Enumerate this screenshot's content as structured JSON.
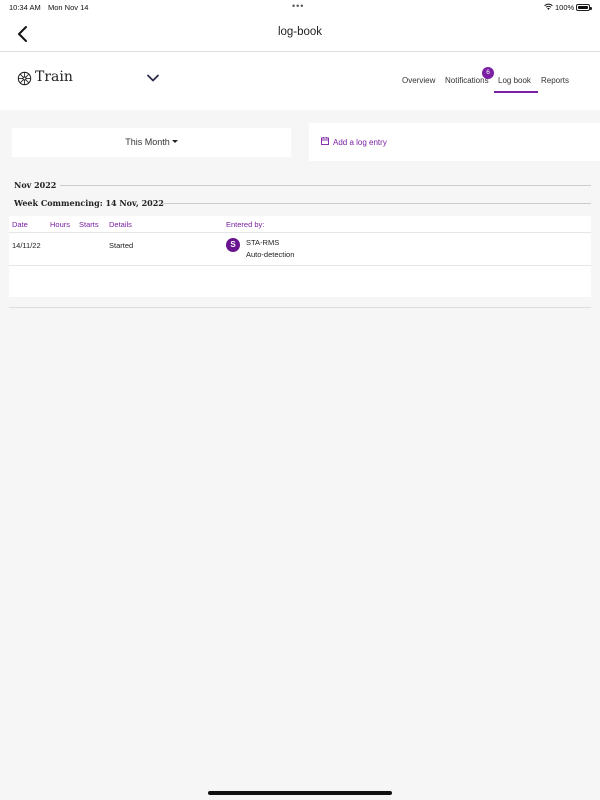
{
  "status_bar": {
    "time": "10:34 AM",
    "date": "Mon Nov 14",
    "battery": "100%",
    "wifi_icon": "wifi-icon",
    "battery_icon": "battery-icon"
  },
  "nav": {
    "title": "log-book",
    "back_icon": "chevron-left-icon"
  },
  "asset": {
    "name": "Train",
    "icon": "wheel-icon",
    "dropdown_icon": "chevron-down-icon"
  },
  "tabs": [
    {
      "label": "Overview"
    },
    {
      "label": "Notifications",
      "badge": "6"
    },
    {
      "label": "Log book",
      "active": true
    },
    {
      "label": "Reports"
    }
  ],
  "filter": {
    "label": "This Month"
  },
  "add_entry": {
    "label": "Add a log entry",
    "icon": "calendar-icon"
  },
  "log": {
    "month": "Nov 2022",
    "week": "Week Commencing: 14 Nov, 2022",
    "columns": [
      "Date",
      "Hours",
      "Starts",
      "Details",
      "Entered by:"
    ],
    "rows": [
      {
        "date": "14/11/22",
        "hours": "",
        "starts": "",
        "details": "Started",
        "avatar_initial": "S",
        "entered_by": "STA-RMS",
        "entered_by_sub": "Auto-detection"
      }
    ]
  },
  "colors": {
    "accent": "#7a1fa2",
    "background": "#f6f6f6",
    "avatar": "#6a1590"
  }
}
